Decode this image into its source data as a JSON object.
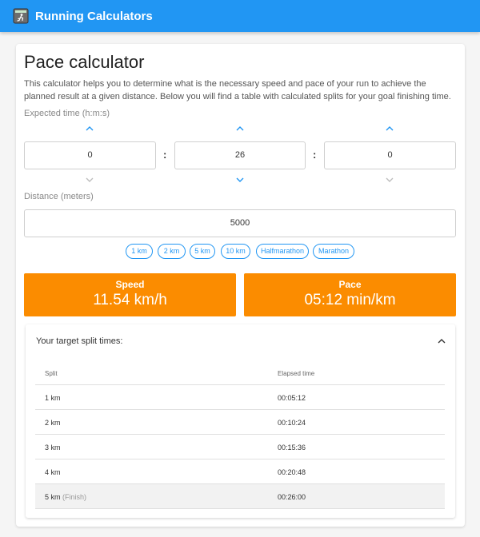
{
  "app": {
    "title": "Running Calculators",
    "logo_icon": "runner-icon"
  },
  "page": {
    "title": "Pace calculator",
    "intro": "This calculator helps you to determine what is the necessary speed and pace of your run to achieve the planned result at a given distance. Below you will find a table with calculated splits for your goal finishing time."
  },
  "time": {
    "label": "Expected time (h:m:s)",
    "hours": "0",
    "minutes": "26",
    "seconds": "0",
    "separator": ":"
  },
  "distance": {
    "label": "Distance (meters)",
    "value": "5000",
    "presets": [
      "1 km",
      "2 km",
      "5 km",
      "10 km",
      "Halfmarathon",
      "Marathon"
    ]
  },
  "results": {
    "speed_label": "Speed",
    "speed_value": "11.54 km/h",
    "pace_label": "Pace",
    "pace_value": "05:12 min/km"
  },
  "splits": {
    "heading": "Your target split times:",
    "columns": [
      "Split",
      "Elapsed time"
    ],
    "rows": [
      {
        "split": "1 km",
        "elapsed": "00:05:12"
      },
      {
        "split": "2 km",
        "elapsed": "00:10:24"
      },
      {
        "split": "3 km",
        "elapsed": "00:15:36"
      },
      {
        "split": "4 km",
        "elapsed": "00:20:48"
      },
      {
        "split": "5 km",
        "note": "(Finish)",
        "elapsed": "00:26:00"
      }
    ]
  },
  "colors": {
    "primary": "#2196f3",
    "accent": "#fb8c00"
  }
}
